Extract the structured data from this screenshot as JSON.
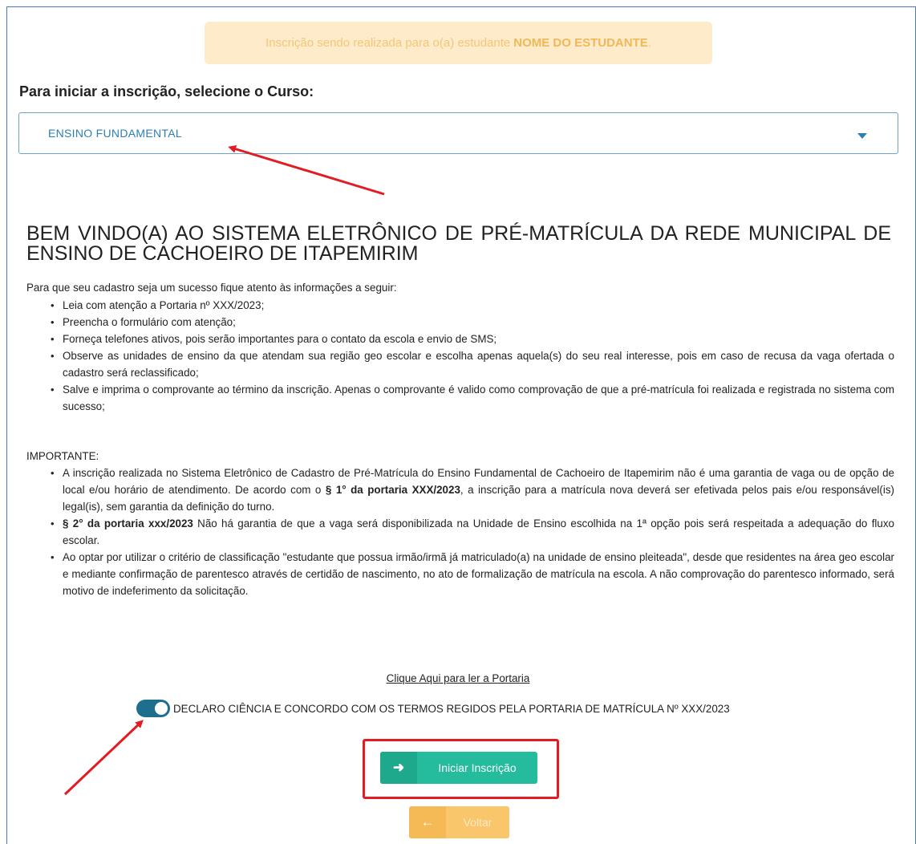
{
  "notice": {
    "prefix": "Inscrição sendo realizada para o(a) estudante",
    "student_name": "NOME DO ESTUDANTE",
    "suffix": "."
  },
  "course": {
    "heading": "Para iniciar a inscrição, selecione o Curso:",
    "selected": "ENSINO FUNDAMENTAL"
  },
  "welcome_title": "BEM VINDO(A) AO SISTEMA ELETRÔNICO DE PRÉ-MATRÍCULA DA REDE MUNICIPAL DE ENSINO DE CACHOEIRO DE ITAPEMIRIM",
  "intro": "Para que seu cadastro seja um sucesso fique atento às informações a seguir:",
  "tips": [
    "Leia com atenção a Portaria nº XXX/2023;",
    "Preencha o formulário com atenção;",
    "Forneça telefones ativos, pois serão importantes para o contato da escola e envio de SMS;",
    "Observe as unidades de ensino da que atendam sua região geo escolar e escolha apenas aquela(s) do seu real interesse, pois em caso de recusa da vaga ofertada o cadastro será reclassificado;",
    "Salve e imprima o comprovante ao término da inscrição. Apenas o comprovante é valido como comprovação de que a pré-matrícula foi realizada e registrada no sistema com sucesso;"
  ],
  "important": {
    "heading": "IMPORTANTE:",
    "item1_a": "A inscrição realizada no Sistema Eletrônico de Cadastro de Pré-Matrícula do Ensino Fundamental de Cachoeiro de Itapemirim não é uma garantia de vaga ou de opção de local e/ou horário de atendimento. De acordo com o",
    "item1_bold": "§ 1° da portaria XXX/2023",
    "item1_b": ", a inscrição para a matrícula nova deverá ser efetivada pelos pais e/ou responsável(is) legal(is), sem garantia da definição do turno.",
    "item2_bold": "§ 2° da portaria xxx/2023",
    "item2_a": " Não há garantia de que a vaga será disponibilizada na Unidade de Ensino escolhida na 1ª opção pois será respeitada a adequação do fluxo escolar.",
    "item3": "Ao optar por utilizar o critério de classificação \"estudante que possua irmão/irmã já matriculado(a) na unidade de ensino pleiteada\", desde que residentes na área geo escolar e mediante confirmação de parentesco através de certidão de nascimento, no ato de formalização de matrícula na escola. A não comprovação do parentesco informado, será motivo de indeferimento da solicitação."
  },
  "portaria_link": "Clique Aqui para ler a Portaria",
  "consent": {
    "label": "DECLARO CIÊNCIA E CONCORDO COM OS TERMOS REGIDOS PELA PORTARIA DE MATRÍCULA Nº XXX/2023",
    "checked": true
  },
  "buttons": {
    "start": "Iniciar Inscrição",
    "back": "Voltar"
  },
  "colors": {
    "start_button": "#25bc9d",
    "back_button": "#f9c66b",
    "annotation": "#e31c23",
    "toggle_on": "#1e6e8e"
  },
  "icons": {
    "start": "arrow-right-icon",
    "back": "arrow-left-icon"
  }
}
